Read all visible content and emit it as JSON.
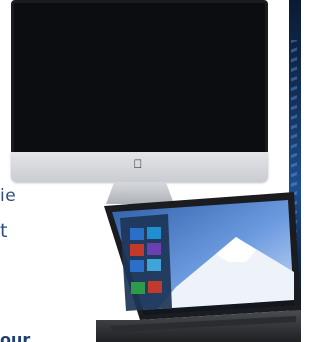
{
  "fragments": {
    "line1": "ie",
    "line2": "t",
    "line3": "our"
  },
  "icons": {
    "apple": "apple-logo-icon"
  },
  "colors": {
    "text_blue": "#2d4d7a",
    "imac_screen": "#0c0d10",
    "laptop_sky": "#5d8fd6",
    "tile_green": "#2e9b4b",
    "tile_red": "#c23a2b",
    "tile_blue": "#2a6fc9"
  }
}
